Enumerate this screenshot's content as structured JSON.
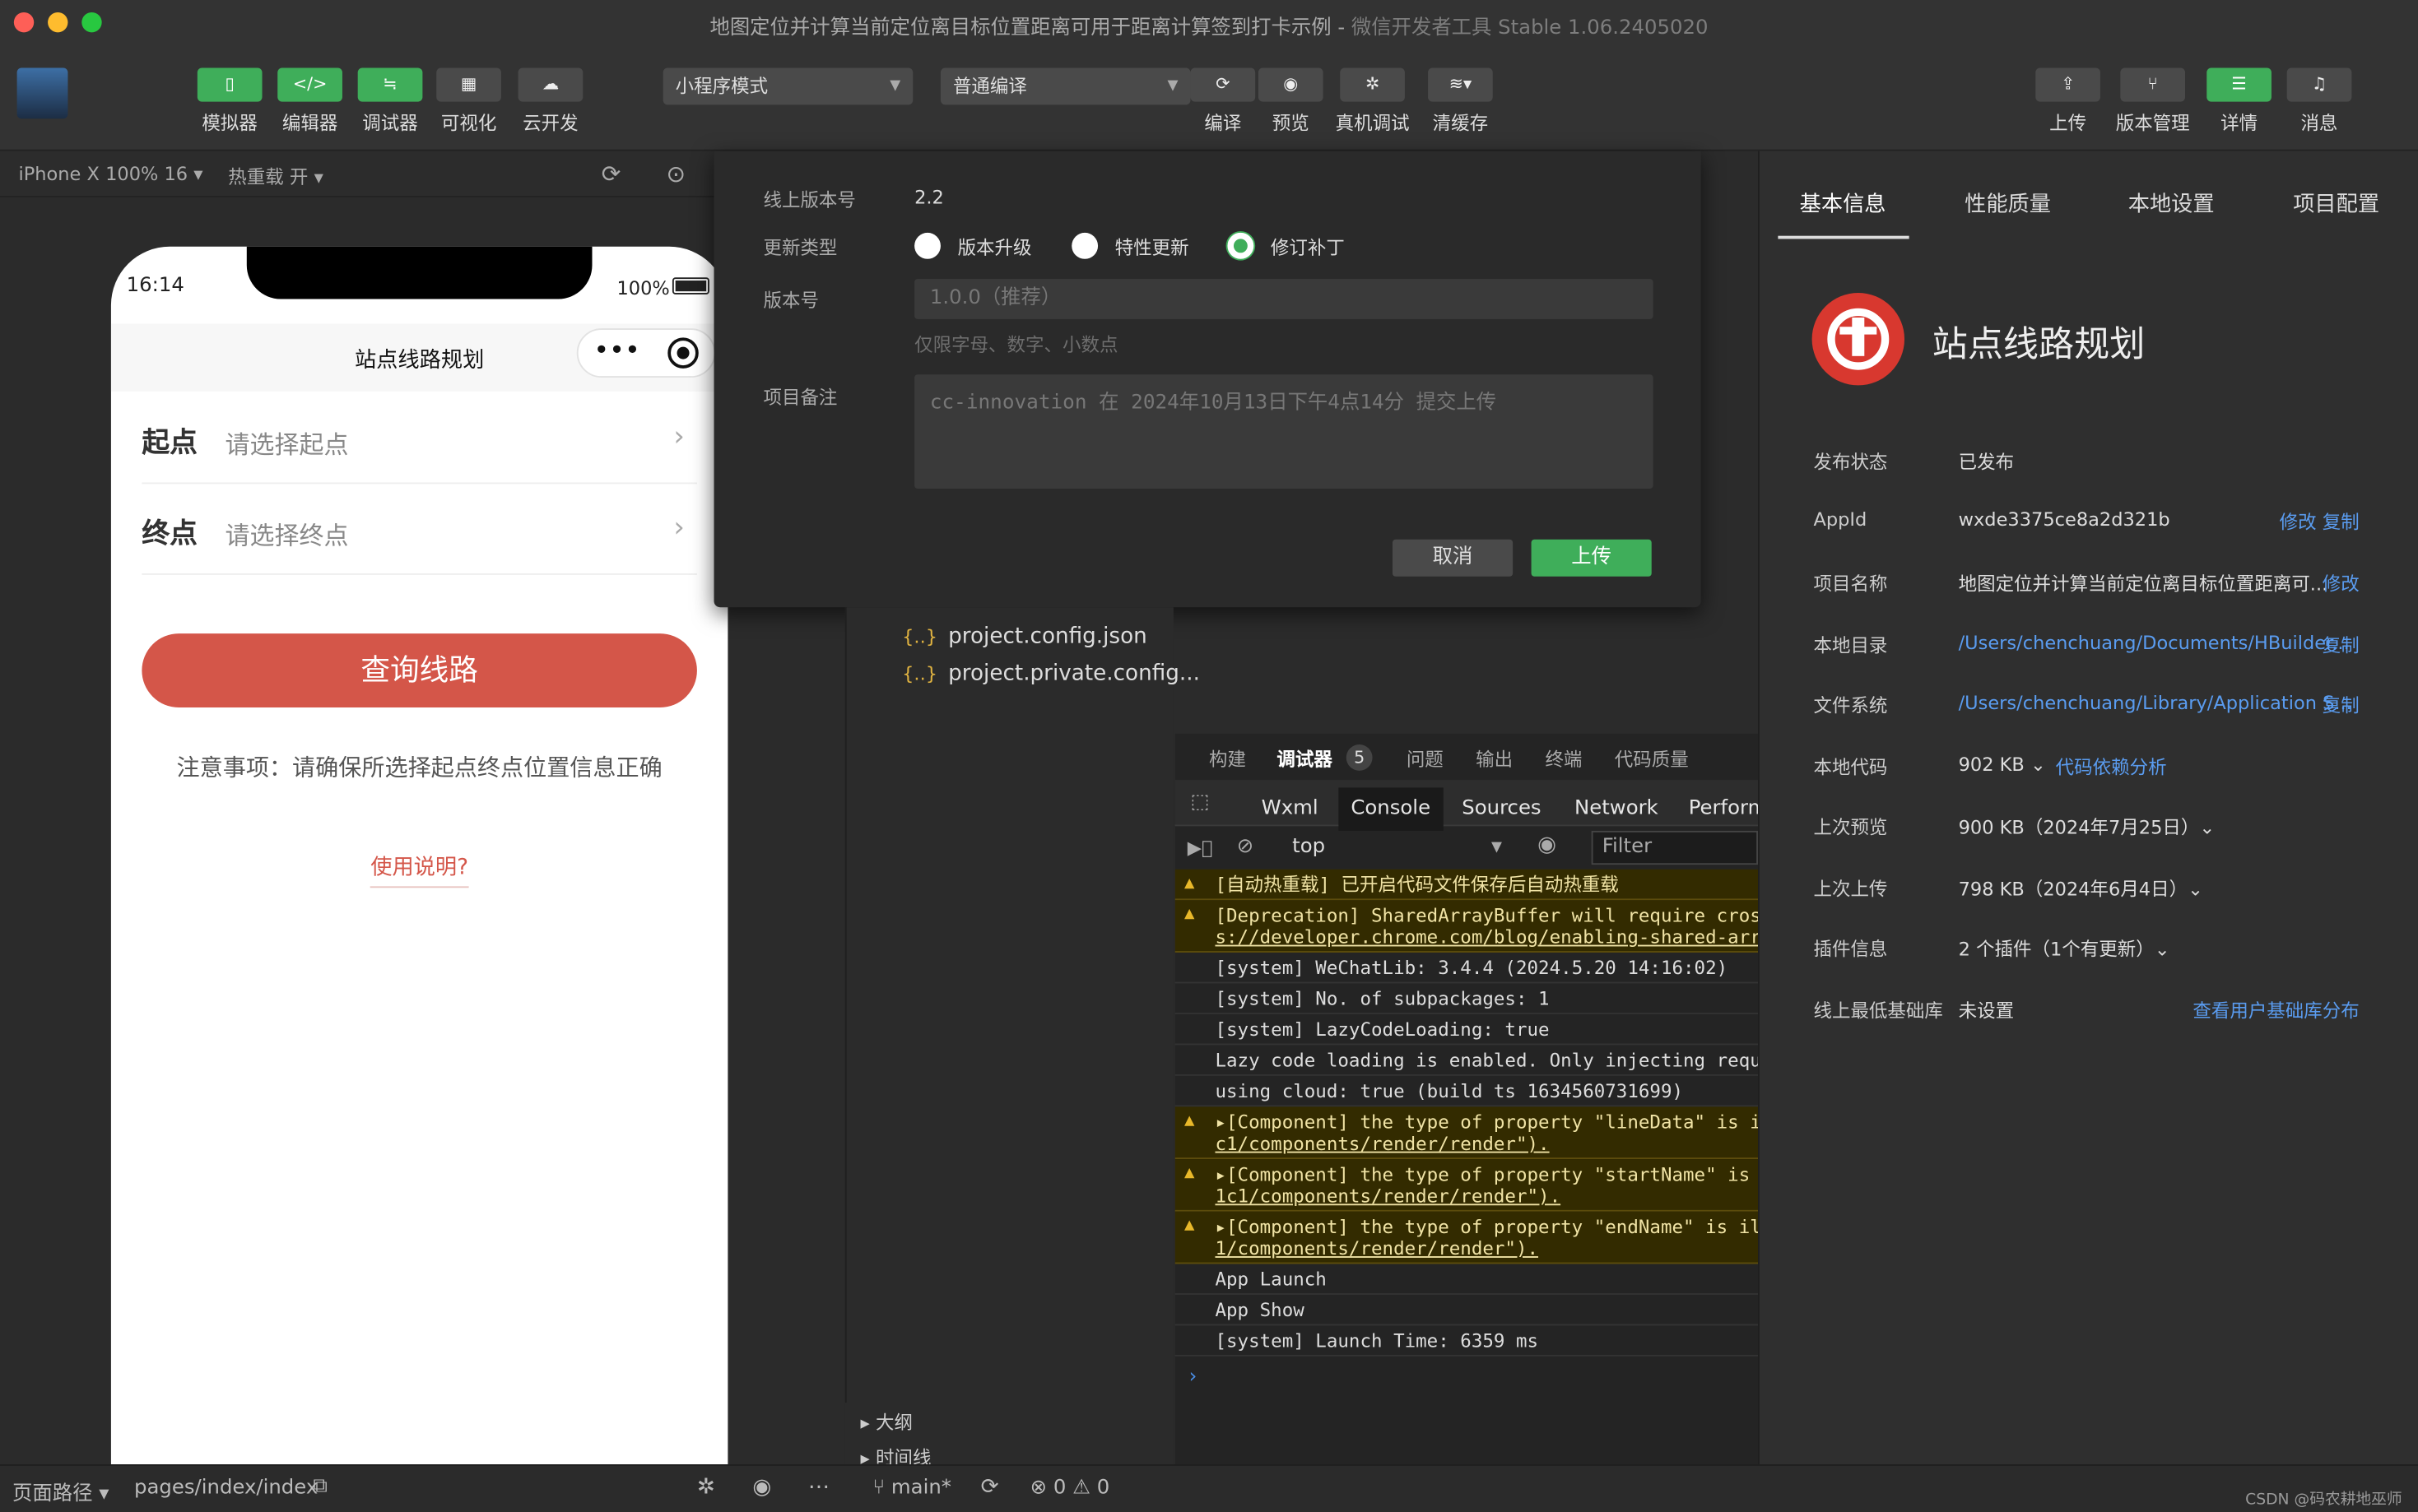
{
  "window": {
    "title": "地图定位并计算当前定位离目标位置距离可用于距离计算签到打卡示例",
    "app_name": "微信开发者工具 Stable 1.06.2405020"
  },
  "toolbar": {
    "left": [
      {
        "label": "模拟器",
        "icon": "phone-icon"
      },
      {
        "label": "编辑器",
        "icon": "code-icon"
      },
      {
        "label": "调试器",
        "icon": "debug-icon"
      },
      {
        "label": "可视化",
        "icon": "layout-icon"
      },
      {
        "label": "云开发",
        "icon": "cloud-icon"
      }
    ],
    "mode_select": "小程序模式",
    "compile_select": "普通编译",
    "center": [
      {
        "label": "编译",
        "icon": "refresh-icon"
      },
      {
        "label": "预览",
        "icon": "eye-icon"
      },
      {
        "label": "真机调试",
        "icon": "bug-icon"
      },
      {
        "label": "清缓存",
        "icon": "layers-icon"
      }
    ],
    "right": [
      {
        "label": "上传",
        "icon": "upload-icon"
      },
      {
        "label": "版本管理",
        "icon": "branch-icon"
      },
      {
        "label": "详情",
        "icon": "list-icon"
      },
      {
        "label": "消息",
        "icon": "bell-icon"
      }
    ]
  },
  "simulator": {
    "device": "iPhone X 100% 16",
    "hot_reload": "热重载 开"
  },
  "phone": {
    "time": "16:14",
    "battery": "100%",
    "nav_title": "站点线路规划",
    "capsule_dots": "•••",
    "start_label": "起点",
    "start_placeholder": "请选择起点",
    "end_label": "终点",
    "end_placeholder": "请选择终点",
    "query_button": "查询线路",
    "note": "注意事项：请确保所选择起点终点位置信息正确",
    "usage_link": "使用说明?"
  },
  "upload_dialog": {
    "online_version_label": "线上版本号",
    "online_version": "2.2",
    "update_type_label": "更新类型",
    "update_types": [
      {
        "label": "版本升级",
        "checked": false
      },
      {
        "label": "特性更新",
        "checked": false
      },
      {
        "label": "修订补丁",
        "checked": true
      }
    ],
    "version_label": "版本号",
    "version_placeholder": "1.0.0（推荐）",
    "version_hint": "仅限字母、数字、小数点",
    "remark_label": "项目备注",
    "remark_placeholder": "cc-innovation 在 2024年10月13日下午4点14分 提交上传",
    "cancel": "取消",
    "upload": "上传"
  },
  "file_tree": [
    "project.config.json",
    "project.private.config..."
  ],
  "outline_items": [
    "大纲",
    "时间线"
  ],
  "debug_panel": {
    "tabs": [
      "构建",
      "调试器",
      "问题",
      "输出",
      "终端",
      "代码质量"
    ],
    "active_tab": "调试器",
    "badge": "5",
    "devtools_tabs": [
      "Wxml",
      "Console",
      "Sources",
      "Network",
      "Perform"
    ],
    "active_devtools_tab": "Console",
    "context": "top",
    "filter_placeholder": "Filter",
    "logs": [
      {
        "type": "warn",
        "lines": [
          "[自动热重载] 已开启代码文件保存后自动热重载"
        ]
      },
      {
        "type": "warn",
        "lines": [
          "[Deprecation] SharedArrayBuffer will require cross",
          "s://developer.chrome.com/blog/enabling-shared-arra"
        ]
      },
      {
        "type": "info",
        "lines": [
          "[system] WeChatLib: 3.4.4 (2024.5.20 14:16:02)"
        ]
      },
      {
        "type": "info",
        "lines": [
          "[system] No. of subpackages: 1"
        ]
      },
      {
        "type": "info",
        "lines": [
          "[system] LazyCodeLoading: true"
        ]
      },
      {
        "type": "info",
        "lines": [
          "Lazy code loading is enabled. Only injecting requi"
        ]
      },
      {
        "type": "info",
        "lines": [
          "using cloud: true (build ts 1634560731699)"
        ]
      },
      {
        "type": "warn",
        "lines": [
          "▸[Component] the type of property \"lineData\" is i",
          "c1/components/render/render\")."
        ]
      },
      {
        "type": "warn",
        "lines": [
          "▸[Component] the type of property \"startName\" is i",
          "1c1/components/render/render\")."
        ]
      },
      {
        "type": "warn",
        "lines": [
          "▸[Component] the type of property \"endName\" is il",
          "1/components/render/render\")."
        ]
      },
      {
        "type": "info",
        "lines": [
          "App Launch"
        ]
      },
      {
        "type": "info",
        "lines": [
          "App Show"
        ]
      },
      {
        "type": "info",
        "lines": [
          "[system] Launch Time: 6359 ms"
        ]
      }
    ]
  },
  "info_panel": {
    "tabs": [
      "基本信息",
      "性能质量",
      "本地设置",
      "项目配置"
    ],
    "app_name": "站点线路规划",
    "rows": [
      {
        "key": "发布状态",
        "value": "已发布",
        "action": ""
      },
      {
        "key": "AppId",
        "value": "wxde3375ce8a2d321b",
        "action": "修改 复制"
      },
      {
        "key": "项目名称",
        "value": "地图定位并计算当前定位离目标位置距离可...",
        "action": "修改"
      },
      {
        "key": "本地目录",
        "value": "/Users/chenchuang/Documents/HBuilder...",
        "action": "复制"
      },
      {
        "key": "文件系统",
        "value": "/Users/chenchuang/Library/Application S...",
        "action": "复制"
      },
      {
        "key": "本地代码",
        "value": "902 KB ⌄",
        "action": "代码依赖分析"
      },
      {
        "key": "上次预览",
        "value": "900 KB（2024年7月25日）⌄",
        "action": ""
      },
      {
        "key": "上次上传",
        "value": "798 KB（2024年6月4日）⌄",
        "action": ""
      },
      {
        "key": "插件信息",
        "value": "2 个插件（1个有更新）⌄",
        "action": ""
      },
      {
        "key": "线上最低基础库",
        "value": "未设置",
        "action": "查看用户基础库分布"
      }
    ]
  },
  "statusbar": {
    "page_path_label": "页面路径",
    "page_path": "pages/index/index",
    "branch": "main*",
    "errors": "0",
    "warnings": "0",
    "watermark": "CSDN @码农耕地巫师"
  },
  "colors": {
    "accent_green": "#3fae5a",
    "primary_red": "#d45649",
    "link_blue": "#5a9cf0"
  }
}
